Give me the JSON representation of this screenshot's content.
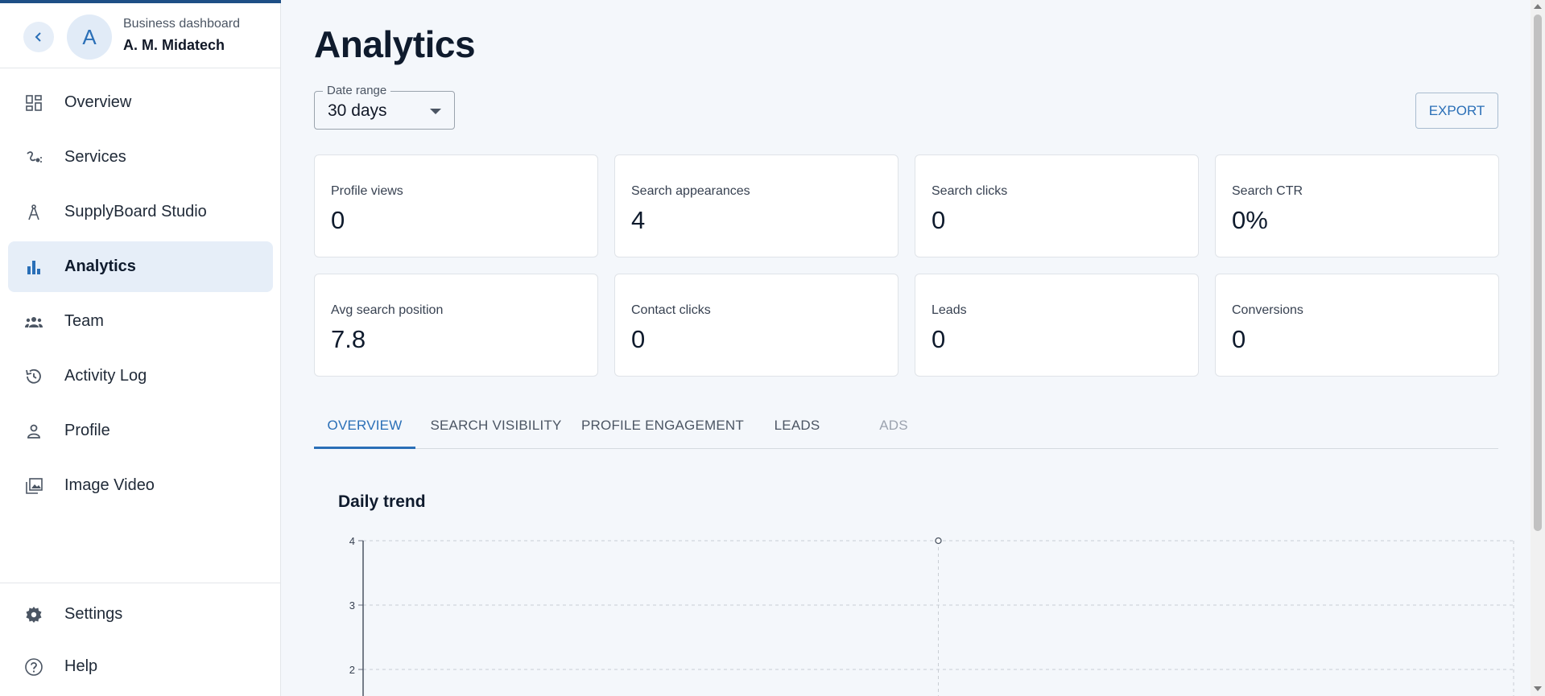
{
  "sidebar": {
    "business_label": "Business dashboard",
    "business_name": "A. M. Midatech",
    "avatar_letter": "A",
    "items": [
      {
        "label": "Overview",
        "icon": "dashboard-icon"
      },
      {
        "label": "Services",
        "icon": "services-icon"
      },
      {
        "label": "SupplyBoard Studio",
        "icon": "compass-icon"
      },
      {
        "label": "Analytics",
        "icon": "bar-chart-icon",
        "active": true
      },
      {
        "label": "Team",
        "icon": "team-icon"
      },
      {
        "label": "Activity Log",
        "icon": "history-icon"
      },
      {
        "label": "Profile",
        "icon": "person-icon"
      },
      {
        "label": "Image Video",
        "icon": "gallery-icon"
      }
    ],
    "bottom_items": [
      {
        "label": "Settings",
        "icon": "gear-icon"
      },
      {
        "label": "Help",
        "icon": "help-icon"
      }
    ]
  },
  "main": {
    "title": "Analytics",
    "date_range": {
      "label": "Date range",
      "value": "30 days"
    },
    "export_label": "EXPORT",
    "kpis": [
      {
        "label": "Profile views",
        "value": "0"
      },
      {
        "label": "Search appearances",
        "value": "4"
      },
      {
        "label": "Search clicks",
        "value": "0"
      },
      {
        "label": "Search CTR",
        "value": "0%"
      },
      {
        "label": "Avg search position",
        "value": "7.8"
      },
      {
        "label": "Contact clicks",
        "value": "0"
      },
      {
        "label": "Leads",
        "value": "0"
      },
      {
        "label": "Conversions",
        "value": "0"
      }
    ],
    "tabs": [
      {
        "label": "OVERVIEW",
        "active": true
      },
      {
        "label": "SEARCH VISIBILITY"
      },
      {
        "label": "PROFILE ENGAGEMENT"
      },
      {
        "label": "LEADS"
      },
      {
        "label": "ADS",
        "disabled": true
      }
    ],
    "chart_title": "Daily trend"
  },
  "colors": {
    "accent": "#2a6fb7",
    "active_bg": "#e6eef8",
    "brand_dark": "#1e4f86"
  },
  "chart_data": {
    "type": "line",
    "title": "Daily trend",
    "y_ticks": [
      2,
      3,
      4
    ],
    "ylim": [
      1.5,
      4
    ],
    "grid": true,
    "series": [
      {
        "values": [
          {
            "x_fraction": 0.5,
            "y": 4
          }
        ]
      }
    ]
  }
}
